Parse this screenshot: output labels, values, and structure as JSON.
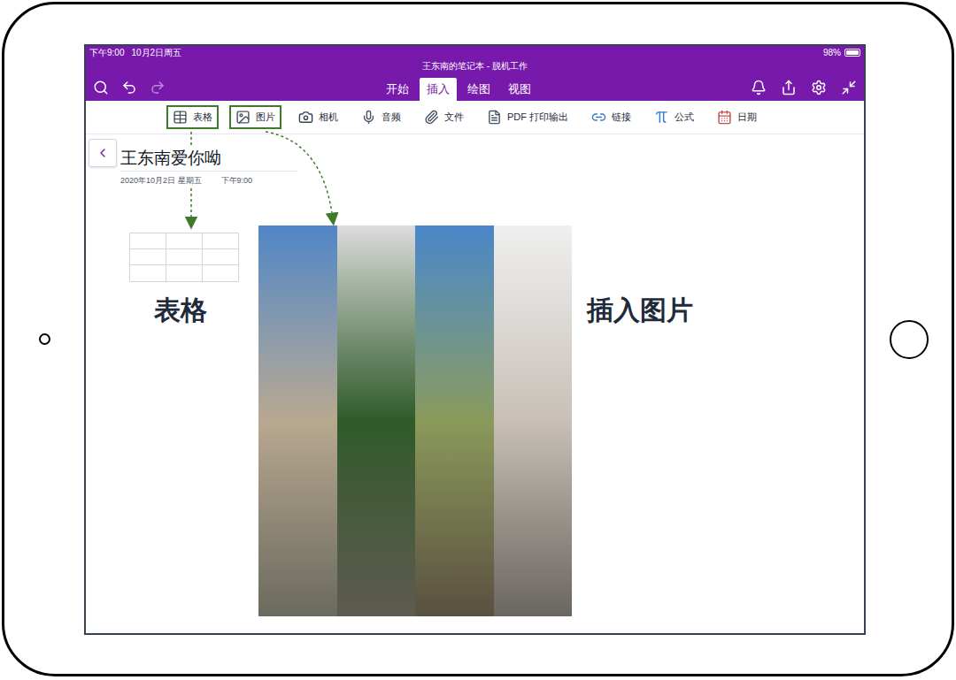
{
  "status_bar": {
    "time": "下午9:00",
    "date": "10月2日周五",
    "battery": "98%",
    "battery_level": 0.98
  },
  "window": {
    "title": "王东南的笔记本 - 脱机工作"
  },
  "tabs": [
    {
      "label": "开始",
      "selected": false
    },
    {
      "label": "插入",
      "selected": true
    },
    {
      "label": "绘图",
      "selected": false
    },
    {
      "label": "视图",
      "selected": false
    }
  ],
  "ribbon": [
    {
      "label": "表格",
      "highlighted": true
    },
    {
      "label": "图片",
      "highlighted": true
    },
    {
      "label": "相机",
      "highlighted": false
    },
    {
      "label": "音频",
      "highlighted": false
    },
    {
      "label": "文件",
      "highlighted": false
    },
    {
      "label": "PDF 打印输出",
      "highlighted": false
    },
    {
      "label": "链接",
      "highlighted": false
    },
    {
      "label": "公式",
      "highlighted": false
    },
    {
      "label": "日期",
      "highlighted": false
    }
  ],
  "page": {
    "title": "王东南爱你呦",
    "date": "2020年10月2日 星期五",
    "time": "下午9:00"
  },
  "inserted_table": {
    "rows": 3,
    "columns": 3
  },
  "annotations": {
    "table_label": "表格",
    "image_label": "插入图片"
  }
}
